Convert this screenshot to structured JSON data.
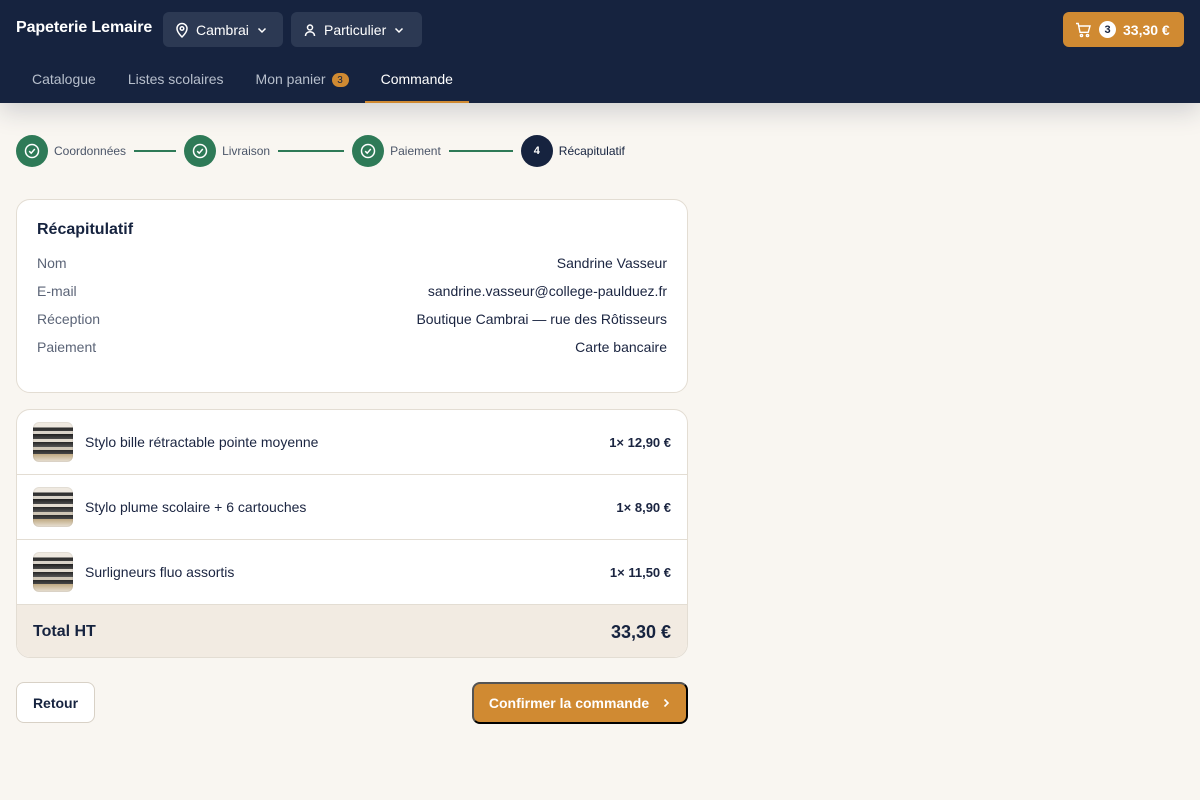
{
  "header": {
    "brand": "Papeterie Lemaire",
    "location": {
      "label": "Cambrai",
      "icon": "map-pin-icon"
    },
    "profile": {
      "label": "Particulier",
      "icon": "user-icon"
    },
    "cart": {
      "count": "3",
      "total": "33,30 €",
      "icon": "cart-icon"
    }
  },
  "nav": {
    "items": [
      {
        "label": "Catalogue"
      },
      {
        "label": "Listes scolaires"
      },
      {
        "label": "Mon panier",
        "badge": "3"
      },
      {
        "label": "Commande",
        "active": true
      }
    ]
  },
  "steps": [
    {
      "label": "Coordonnées",
      "status": "done"
    },
    {
      "label": "Livraison",
      "status": "done"
    },
    {
      "label": "Paiement",
      "status": "done"
    },
    {
      "number": "4",
      "label": "Récapitulatif",
      "status": "current"
    }
  ],
  "summary": {
    "title": "Récapitulatif",
    "rows": [
      {
        "key": "Nom",
        "value": "Sandrine Vasseur"
      },
      {
        "key": "E-mail",
        "value": "sandrine.vasseur@college-paulduez.fr"
      },
      {
        "key": "Réception",
        "value": "Boutique Cambrai — rue des Rôtisseurs"
      },
      {
        "key": "Paiement",
        "value": "Carte bancaire"
      }
    ]
  },
  "items": [
    {
      "name": "Stylo bille rétractable pointe moyenne",
      "qty_price": "1× 12,90 €"
    },
    {
      "name": "Stylo plume scolaire + 6 cartouches",
      "qty_price": "1× 8,90 €"
    },
    {
      "name": "Surligneurs fluo assortis",
      "qty_price": "1× 11,50 €"
    }
  ],
  "total": {
    "label": "Total HT",
    "amount": "33,30 €"
  },
  "actions": {
    "back": "Retour",
    "confirm": "Confirmer la commande"
  },
  "colors": {
    "navy": "#16233f",
    "accent": "#d08a32",
    "success": "#2e7a57",
    "background": "#f9f6f1"
  }
}
